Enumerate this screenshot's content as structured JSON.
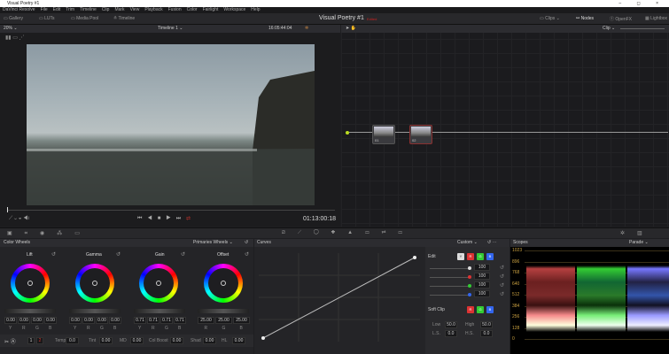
{
  "window": {
    "title": "Visual Poetry #1",
    "controls": "– ◻ ×"
  },
  "menu": [
    "DaVinci Resolve",
    "File",
    "Edit",
    "Trim",
    "Timeline",
    "Clip",
    "Mark",
    "View",
    "Playback",
    "Fusion",
    "Color",
    "Fairlight",
    "Workspace",
    "Help"
  ],
  "toolbar": {
    "gallery": "Gallery",
    "luts": "LUTs",
    "media_pool": "Media Pool",
    "timeline": "Timeline",
    "project": "Visual Poetry #1",
    "status": "Edited",
    "clips": "Clips",
    "nodes": "Nodes",
    "openfx": "OpenFX",
    "lightbox": "Lightbox"
  },
  "viewer": {
    "zoom": "20%",
    "timeline": "Timeline 1",
    "source_tc": "16:05:44:04",
    "timecode": "01:13:00:18"
  },
  "node_editor": {
    "mode": "Clip",
    "nodes": [
      {
        "label": "01"
      },
      {
        "label": "02"
      }
    ]
  },
  "color_wheels": {
    "title": "Color Wheels",
    "mode": "Primaries Wheels",
    "wheels": [
      {
        "name": "Lift",
        "values": [
          "0.00",
          "0.00",
          "0.00",
          "0.00"
        ],
        "channels": [
          "Y",
          "R",
          "G",
          "B"
        ]
      },
      {
        "name": "Gamma",
        "values": [
          "0.00",
          "0.00",
          "0.00",
          "0.00"
        ],
        "channels": [
          "Y",
          "R",
          "G",
          "B"
        ]
      },
      {
        "name": "Gain",
        "values": [
          "0.71",
          "0.71",
          "0.71",
          "0.71"
        ],
        "channels": [
          "Y",
          "R",
          "G",
          "B"
        ]
      },
      {
        "name": "Offset",
        "values": [
          "25.00",
          "25.00",
          "25.00"
        ],
        "channels": [
          "R",
          "G",
          "B"
        ]
      }
    ],
    "page1": "1",
    "page2": "2",
    "adjust": [
      {
        "label": "Temp",
        "value": "0.0"
      },
      {
        "label": "Tint",
        "value": "0.00"
      },
      {
        "label": "MD",
        "value": "0.00"
      },
      {
        "label": "Col Boost",
        "value": "0.00"
      },
      {
        "label": "Shad",
        "value": "0.00"
      },
      {
        "label": "HL",
        "value": "0.00"
      }
    ]
  },
  "curves": {
    "title": "Curves",
    "mode": "Custom",
    "edit": "Edit",
    "channels": [
      "Y",
      "R",
      "G",
      "B"
    ],
    "intensity": [
      "100",
      "100",
      "100",
      "100"
    ],
    "soft_clip": "Soft Clip",
    "low_label": "Low",
    "low": "50.0",
    "high_label": "High",
    "high": "50.0",
    "ls_label": "L.S.",
    "ls": "0.0",
    "hs_label": "H.S.",
    "hs": "0.0"
  },
  "scopes": {
    "title": "Scopes",
    "mode": "Parade",
    "ticks": [
      "1023",
      "896",
      "768",
      "640",
      "512",
      "384",
      "256",
      "128",
      "0"
    ]
  },
  "colors": {
    "accent": "#d0342c",
    "bg": "#1e1e21"
  }
}
